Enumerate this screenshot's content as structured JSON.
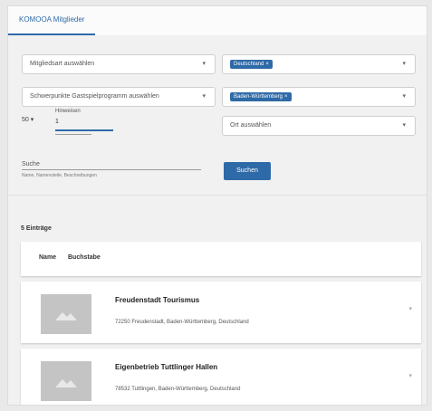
{
  "tab": {
    "label": "KOMOOA Mitglieder"
  },
  "filters": {
    "member_type": {
      "value": "Mitgliedsart auswählen"
    },
    "country": {
      "chip": "Deutschland"
    },
    "focus": {
      "value": "Schwerpunkte Gastspielprogramm auswählen"
    },
    "state": {
      "chip": "Baden-Württemberg"
    },
    "place": {
      "value": "Ort auswählen"
    },
    "per_page": {
      "value": "50"
    },
    "hits": {
      "label": "Hinweisen",
      "value": "1"
    },
    "search": {
      "label": "Suche",
      "hint": "Name, Namensteile, Beschreibungen"
    },
    "search_button": "Suchen"
  },
  "results": {
    "count": "5 Einträge",
    "sort": {
      "name": "Name",
      "letter": "Buchstabe"
    },
    "items": [
      {
        "name": "Freudenstadt Tourismus",
        "address": "72250 Freudenstadt, Baden-Württemberg, Deutschland"
      },
      {
        "name": "Eigenbetrieb Tuttlinger Hallen",
        "address": "78532 Tuttlingen, Baden-Württemberg, Deutschland"
      }
    ]
  },
  "colors": {
    "accent": "#2f6aa8",
    "thumb": "#c4c4c4"
  },
  "icons": {
    "dropdown": "chevron-down-icon",
    "remove": "close-icon",
    "placeholder": "image-placeholder-icon",
    "expand": "chevron-down-icon"
  }
}
